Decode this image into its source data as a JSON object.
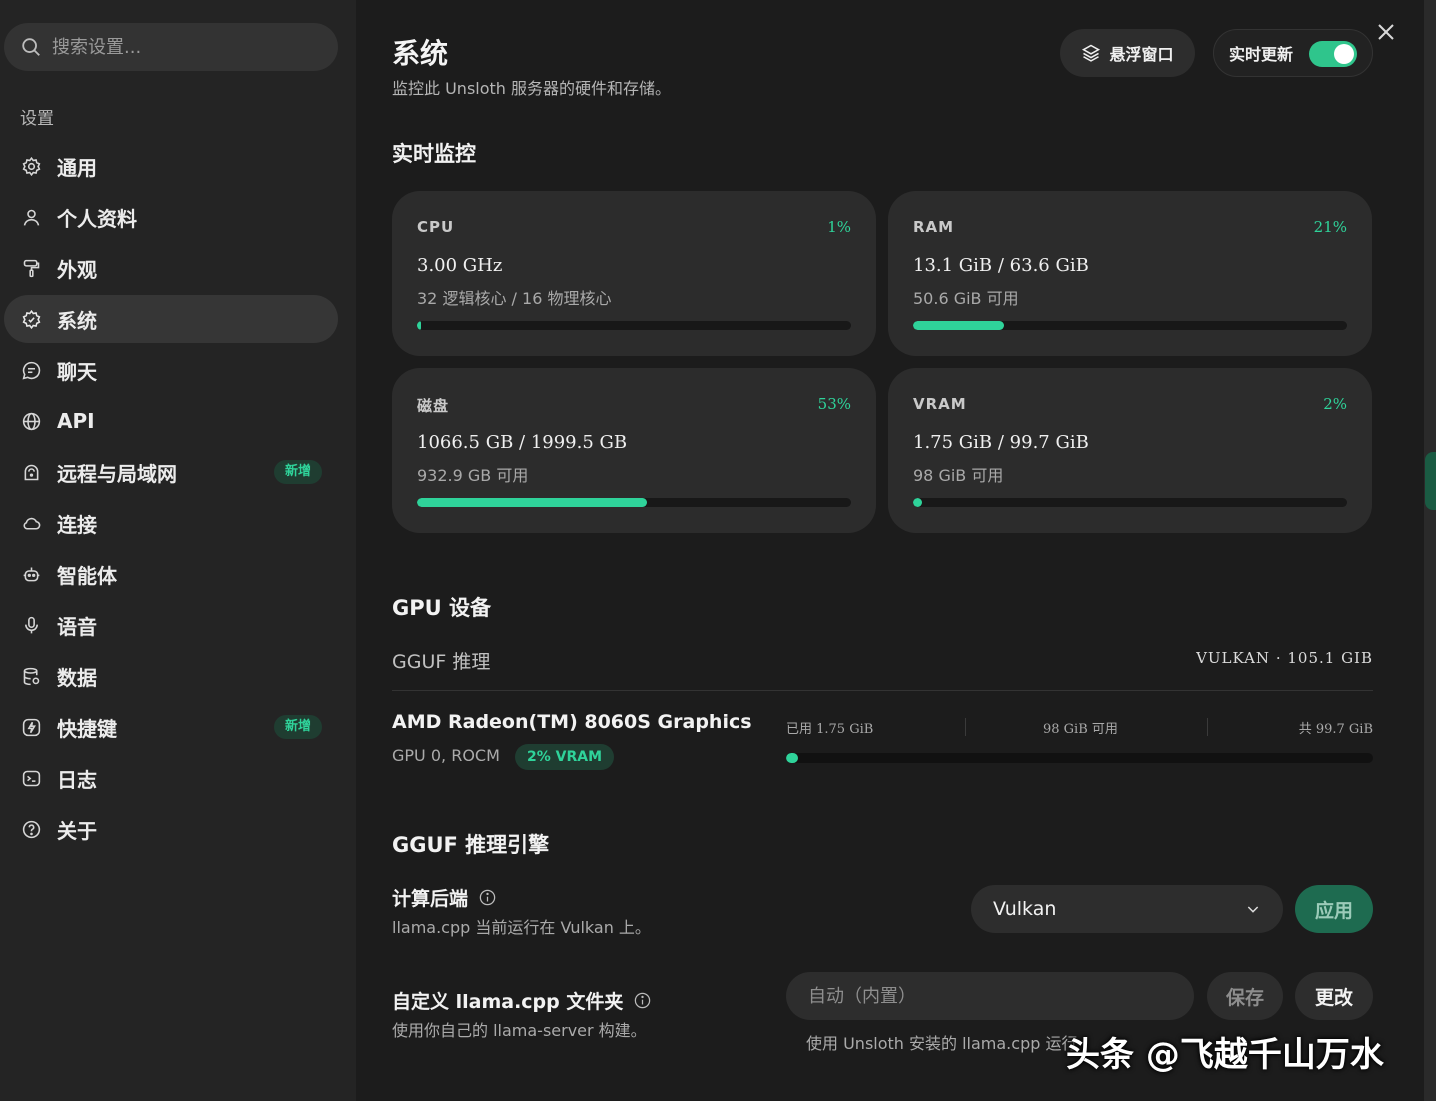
{
  "sidebar": {
    "search_placeholder": "搜索设置...",
    "section_label": "设置",
    "items": [
      {
        "label": "通用",
        "icon": "gear-icon"
      },
      {
        "label": "个人资料",
        "icon": "user-icon"
      },
      {
        "label": "外观",
        "icon": "paint-roller-icon"
      },
      {
        "label": "系统",
        "icon": "system-gear-icon",
        "active": true
      },
      {
        "label": "聊天",
        "icon": "chat-icon"
      },
      {
        "label": "API",
        "icon": "globe-icon"
      },
      {
        "label": "远程与局域网",
        "icon": "router-icon",
        "badge": "新增"
      },
      {
        "label": "连接",
        "icon": "cloud-icon"
      },
      {
        "label": "智能体",
        "icon": "robot-icon"
      },
      {
        "label": "语音",
        "icon": "microphone-icon"
      },
      {
        "label": "数据",
        "icon": "database-icon"
      },
      {
        "label": "快捷键",
        "icon": "lightning-icon",
        "badge": "新增"
      },
      {
        "label": "日志",
        "icon": "terminal-icon"
      },
      {
        "label": "关于",
        "icon": "help-icon"
      }
    ]
  },
  "header": {
    "title": "系统",
    "subtitle": "监控此 Unsloth 服务器的硬件和存储。",
    "float_window_label": "悬浮窗口",
    "live_update_label": "实时更新",
    "live_update_on": true
  },
  "monitor": {
    "title": "实时监控",
    "cards": [
      {
        "label": "CPU",
        "percent_text": "1%",
        "percent": 1,
        "value": "3.00 GHz",
        "sub": "32 逻辑核心 / 16 物理核心"
      },
      {
        "label": "RAM",
        "percent_text": "21%",
        "percent": 21,
        "value": "13.1 GiB / 63.6 GiB",
        "sub": "50.6 GiB 可用"
      },
      {
        "label": "磁盘",
        "percent_text": "53%",
        "percent": 53,
        "value": "1066.5 GB / 1999.5 GB",
        "sub": "932.9 GB 可用"
      },
      {
        "label": "VRAM",
        "percent_text": "2%",
        "percent": 2,
        "value": "1.75 GiB / 99.7 GiB",
        "sub": "98 GiB 可用"
      }
    ]
  },
  "gpu": {
    "title": "GPU 设备",
    "inference_label": "GGUF 推理",
    "backend_summary": "VULKAN · 105.1 GIB",
    "device_name": "AMD Radeon(TM) 8060S Graphics",
    "device_meta": "GPU 0, ROCM",
    "vram_badge": "2% VRAM",
    "used": "已用 1.75 GiB",
    "free": "98 GiB 可用",
    "total": "共 99.7 GiB",
    "used_percent": 2
  },
  "engine": {
    "title": "GGUF 推理引擎",
    "compute_label": "计算后端",
    "compute_desc": "llama.cpp 当前运行在 Vulkan 上。",
    "backend_selected": "Vulkan",
    "apply_label": "应用",
    "custom_label": "自定义 llama.cpp 文件夹",
    "custom_desc": "使用你自己的 llama-server 构建。",
    "path_placeholder": "自动（内置）",
    "save_label": "保存",
    "change_label": "更改",
    "path_hint": "使用 Unsloth 安装的 llama.cpp 运行"
  },
  "watermark": "头条 @飞越千山万水",
  "colors": {
    "accent": "#2fd39a",
    "toggle": "#2fc58c",
    "badge_bg": "#1f3d31"
  }
}
